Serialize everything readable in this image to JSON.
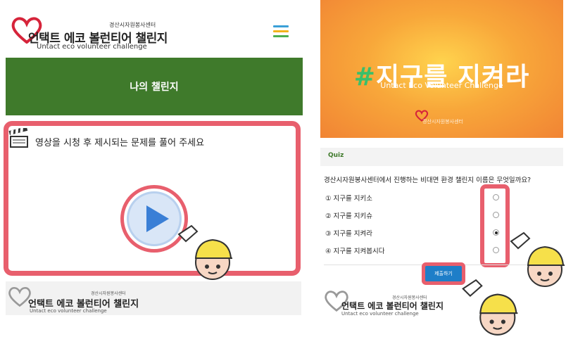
{
  "left": {
    "header": {
      "org": "경산시자원봉사센터",
      "title": "언택트 에코 볼런티어 챌린지",
      "subtitle": "Untact eco volunteer challenge"
    },
    "banner": {
      "label": "나의 챌린지"
    },
    "video": {
      "instruction": "영상을 시청 후 제시되는 문제를 풀어 주세요"
    },
    "footer": {
      "org": "경산시자원봉사센터",
      "title": "언택트 에코 볼런티어 챌린지",
      "subtitle": "Untact eco volunteer challenge"
    }
  },
  "right": {
    "hero": {
      "hash": "#",
      "title": "지구를 지켜라",
      "subtitle": "Untact Eco Volunteer Challenge",
      "org": "경산시자원봉사센터"
    },
    "quiz": {
      "label": "Quiz",
      "question": "경산시자원봉사센터에서 진행하는 비대면 환경 챌린지 이름은 무엇일까요?",
      "options": [
        {
          "label": "① 지구를 지키소",
          "checked": false
        },
        {
          "label": "② 지구를 지키슈",
          "checked": false
        },
        {
          "label": "③ 지구를 지켜라",
          "checked": true
        },
        {
          "label": "④ 지구를 지켜봅시다",
          "checked": false
        }
      ],
      "submit_label": "제출하기"
    },
    "footer": {
      "org": "경산시자원봉사센터",
      "title": "언택트 에코 볼런티어 챌린지",
      "subtitle": "Untact eco volunteer challenge"
    }
  },
  "colors": {
    "accent_red": "#e85f6d",
    "banner_green": "#3f7a2b",
    "submit_blue": "#1e7ec8",
    "logo_red": "#d6243a"
  },
  "icons": [
    "heart-logo-icon",
    "menu-icon",
    "clapperboard-icon",
    "play-icon",
    "mascot-pointing-icon"
  ]
}
